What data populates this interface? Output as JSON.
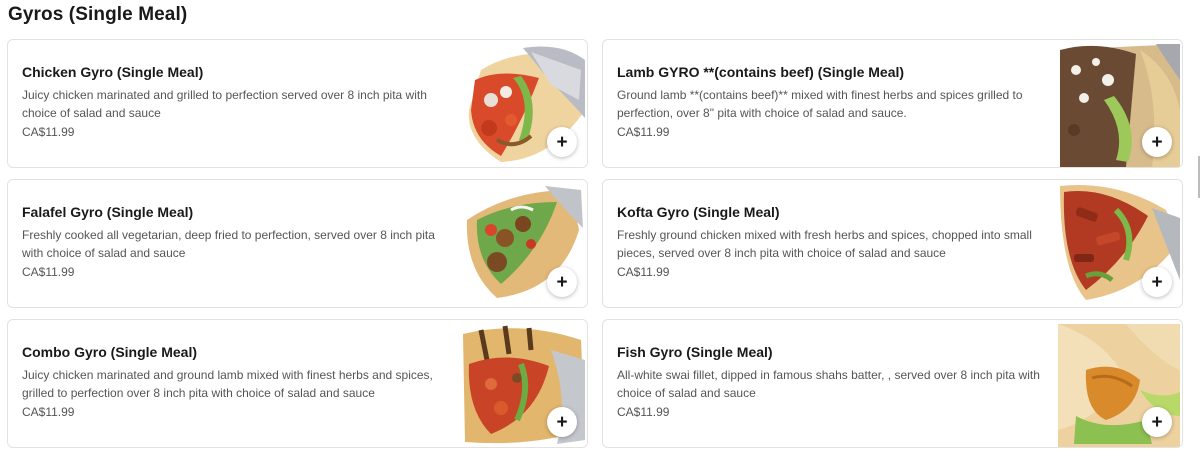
{
  "section": {
    "title": "Gyros (Single Meal)"
  },
  "items": [
    {
      "name": "Chicken Gyro (Single Meal)",
      "description": "Juicy chicken marinated and grilled to perfection served over 8 inch pita with choice of salad and sauce",
      "price": "CA$11.99",
      "add_label": "+",
      "image": "chicken-gyro-photo"
    },
    {
      "name": "Lamb GYRO **(contains beef) (Single Meal)",
      "description": "Ground lamb **(contains beef)** mixed with finest herbs and spices grilled to perfection, over 8\" pita with choice of salad and sauce.",
      "price": "CA$11.99",
      "add_label": "+",
      "image": "lamb-gyro-photo"
    },
    {
      "name": "Falafel Gyro (Single Meal)",
      "description": "Freshly cooked all vegetarian, deep fried to perfection, served over 8 inch pita with choice of salad and sauce",
      "price": "CA$11.99",
      "add_label": "+",
      "image": "falafel-gyro-photo"
    },
    {
      "name": "Kofta Gyro (Single Meal)",
      "description": "Freshly ground chicken mixed with fresh herbs and spices, chopped into small pieces, served over 8 inch pita with choice of salad and sauce",
      "price": "CA$11.99",
      "add_label": "+",
      "image": "kofta-gyro-photo"
    },
    {
      "name": "Combo Gyro (Single Meal)",
      "description": "Juicy chicken marinated and ground lamb mixed with finest herbs and spices, grilled to perfection over 8 inch pita with choice of salad and sauce",
      "price": "CA$11.99",
      "add_label": "+",
      "image": "combo-gyro-photo"
    },
    {
      "name": "Fish Gyro (Single Meal)",
      "description": "All-white swai fillet, dipped in famous shahs batter, , served over 8 inch pita with choice of salad and sauce",
      "price": "CA$11.99",
      "add_label": "+",
      "image": "fish-gyro-photo"
    }
  ]
}
